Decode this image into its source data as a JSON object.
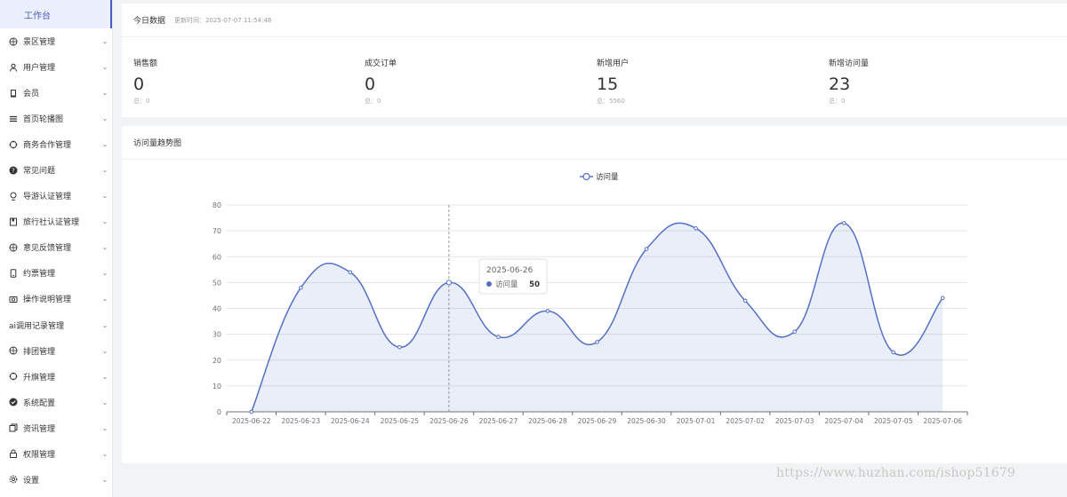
{
  "sidebar": {
    "top_label": "工作台",
    "items": [
      {
        "label": "景区管理",
        "icon": "globe-icon"
      },
      {
        "label": "用户管理",
        "icon": "user-icon"
      },
      {
        "label": "会员",
        "icon": "cup-icon"
      },
      {
        "label": "首页轮播图",
        "icon": "menu-icon"
      },
      {
        "label": "商务合作管理",
        "icon": "compass-icon"
      },
      {
        "label": "常见问题",
        "icon": "question-icon"
      },
      {
        "label": "导游认证管理",
        "icon": "location-icon"
      },
      {
        "label": "旅行社认证管理",
        "icon": "notebook-icon"
      },
      {
        "label": "意见反馈管理",
        "icon": "globe-icon"
      },
      {
        "label": "约票管理",
        "icon": "phone-icon"
      },
      {
        "label": "操作说明管理",
        "icon": "camera-icon"
      },
      {
        "label": "ai调用记录管理",
        "icon": ""
      },
      {
        "label": "排团管理",
        "icon": "globe-icon"
      },
      {
        "label": "升旗管理",
        "icon": "compass-icon"
      },
      {
        "label": "系统配置",
        "icon": "check-circle-icon"
      },
      {
        "label": "资讯管理",
        "icon": "copy-icon"
      },
      {
        "label": "权限管理",
        "icon": "lock-icon"
      },
      {
        "label": "设置",
        "icon": "gear-icon"
      }
    ]
  },
  "today": {
    "title": "今日数据",
    "updated": "更新时间：2025-07-07 11:54:48",
    "stats": [
      {
        "label": "销售额",
        "value": "0",
        "total": "总：0"
      },
      {
        "label": "成交订单",
        "value": "0",
        "total": "总：0"
      },
      {
        "label": "新增用户",
        "value": "15",
        "total": "总：5560"
      },
      {
        "label": "新增访问量",
        "value": "23",
        "total": "总：0"
      }
    ]
  },
  "trend": {
    "title": "访问量趋势图",
    "tooltip": {
      "date": "2025-06-26",
      "series": "访问量",
      "value": "50"
    }
  },
  "chart_data": {
    "type": "line",
    "smooth": true,
    "area": true,
    "categories": [
      "2025-06-22",
      "2025-06-23",
      "2025-06-24",
      "2025-06-25",
      "2025-06-26",
      "2025-06-27",
      "2025-06-28",
      "2025-06-29",
      "2025-06-30",
      "2025-07-01",
      "2025-07-02",
      "2025-07-03",
      "2025-07-04",
      "2025-07-05",
      "2025-07-06"
    ],
    "series": [
      {
        "name": "访问量",
        "values": [
          0,
          48,
          54,
          25,
          50,
          29,
          39,
          27,
          63,
          71,
          43,
          31,
          73,
          23,
          44
        ]
      }
    ],
    "ylim": [
      0,
      80
    ],
    "yticks": [
      0,
      10,
      20,
      30,
      40,
      50,
      60,
      70,
      80
    ],
    "legend": "top-center",
    "grid": true,
    "color": "#5470c6"
  },
  "watermark": "https://www.huzhan.com/ishop51679"
}
